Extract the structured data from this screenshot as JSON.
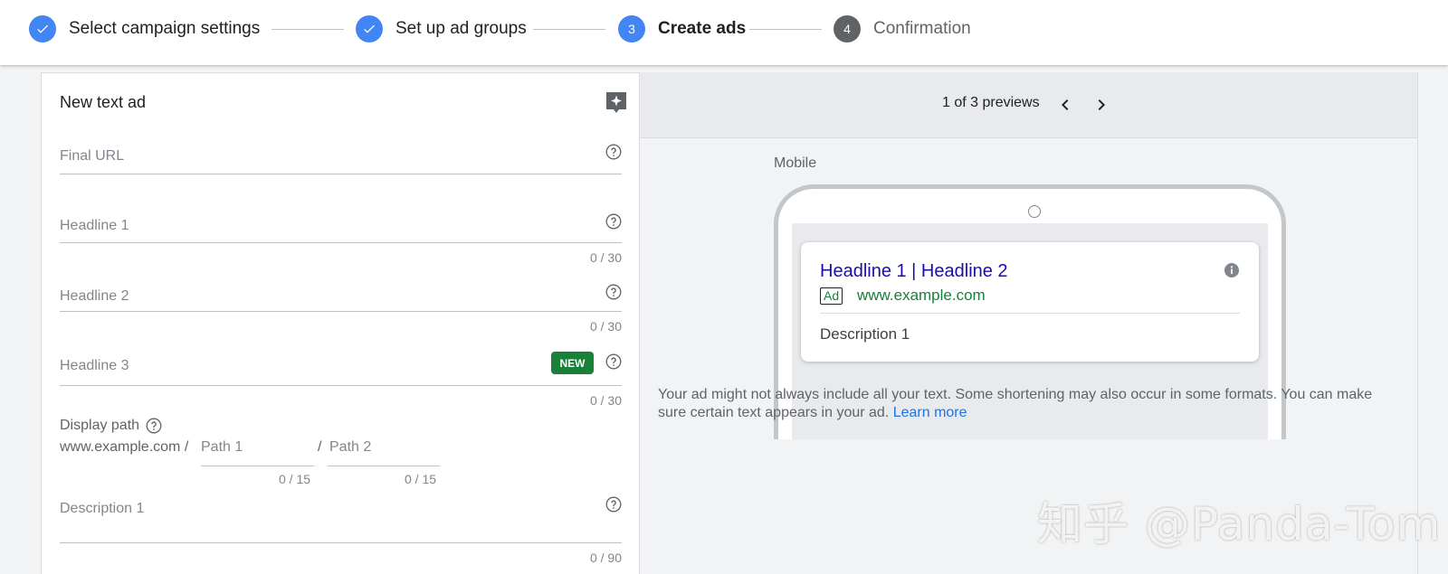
{
  "stepper": {
    "steps": [
      {
        "number": "1",
        "label": "Select campaign settings",
        "state": "done"
      },
      {
        "number": "2",
        "label": "Set up ad groups",
        "state": "done"
      },
      {
        "number": "3",
        "label": "Create ads",
        "state": "active"
      },
      {
        "number": "4",
        "label": "Confirmation",
        "state": "todo"
      }
    ]
  },
  "editor": {
    "title": "New text ad",
    "final_url": {
      "label": "Final URL"
    },
    "headline1": {
      "label": "Headline 1",
      "count": "0 / 30"
    },
    "headline2": {
      "label": "Headline 2",
      "count": "0 / 30"
    },
    "headline3": {
      "label": "Headline 3",
      "count": "0 / 30",
      "badge": "NEW"
    },
    "display_path": {
      "label": "Display path",
      "domain": "www.example.com /",
      "path1": "Path 1",
      "path1_count": "0 / 15",
      "separator": "/",
      "path2": "Path 2",
      "path2_count": "0 / 15"
    },
    "description1": {
      "label": "Description 1",
      "count": "0 / 90"
    }
  },
  "preview": {
    "counter": "1 of 3 previews",
    "device_label": "Mobile",
    "ad": {
      "headline": "Headline 1 | Headline 2",
      "badge": "Ad",
      "url": "www.example.com",
      "description": "Description 1"
    },
    "disclaimer": "Your ad might not always include all your text. Some shortening may also occur in some formats. You can make sure certain text appears in your ad.",
    "learn_more": "Learn more"
  },
  "watermark": "知乎 @Panda-Tom",
  "colors": {
    "accent": "#4285f4",
    "new_badge": "#188038",
    "ad_headline": "#1a0dab",
    "ad_url": "#188038",
    "link": "#1a73e8"
  },
  "icons": [
    "check-icon",
    "ai-sparkle-icon",
    "help-icon",
    "chevron-left-icon",
    "chevron-right-icon",
    "info-icon"
  ]
}
